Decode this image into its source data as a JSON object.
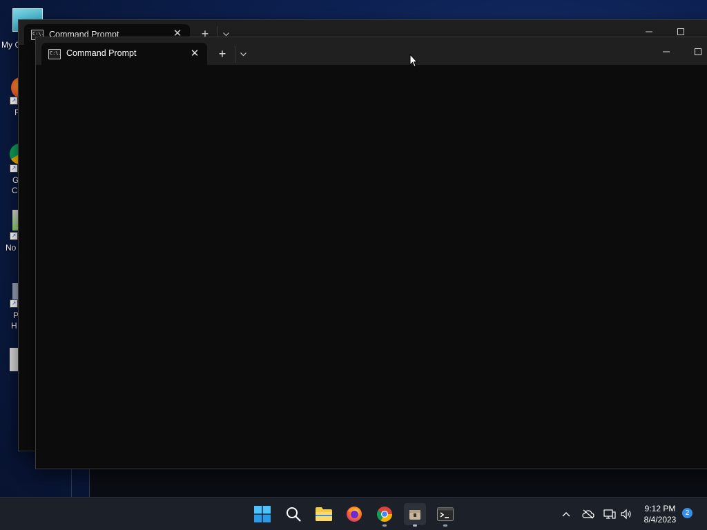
{
  "desktop": {
    "icons": [
      {
        "name": "this-pc",
        "label_visible": "My C"
      },
      {
        "name": "firefox",
        "label_visible": "F"
      },
      {
        "name": "chrome",
        "label_visible_line1": "G",
        "label_visible_line2": "C"
      },
      {
        "name": "notepad",
        "label_visible": "No"
      },
      {
        "name": "pc-health",
        "label_visible_line1": "P",
        "label_visible_line2": "H"
      }
    ]
  },
  "back_window": {
    "tab_title": "Command Prompt",
    "tab_icon_text": "C:\\."
  },
  "front_window": {
    "tab_title": "Command Prompt",
    "tab_icon_text": "C:\\.",
    "new_tab_label": "+"
  },
  "taskbar": {
    "pinned": [
      {
        "name": "start",
        "icon": "windows-logo-icon"
      },
      {
        "name": "search",
        "icon": "search-icon"
      },
      {
        "name": "file-explorer",
        "icon": "folder-icon"
      },
      {
        "name": "firefox",
        "icon": "firefox-icon"
      },
      {
        "name": "chrome",
        "icon": "chrome-icon",
        "running": true
      },
      {
        "name": "unknown-app",
        "icon": "package-icon",
        "running": true,
        "active": true
      },
      {
        "name": "terminal",
        "icon": "terminal-icon",
        "running": true
      }
    ],
    "tray": {
      "time": "9:12 PM",
      "date": "8/4/2023",
      "notification_count": "2"
    }
  },
  "colors": {
    "terminal_bg": "#0c0c0c",
    "titlebar_bg": "#202020",
    "taskbar_bg": "#1c2029",
    "accent": "#3a8ee6"
  }
}
